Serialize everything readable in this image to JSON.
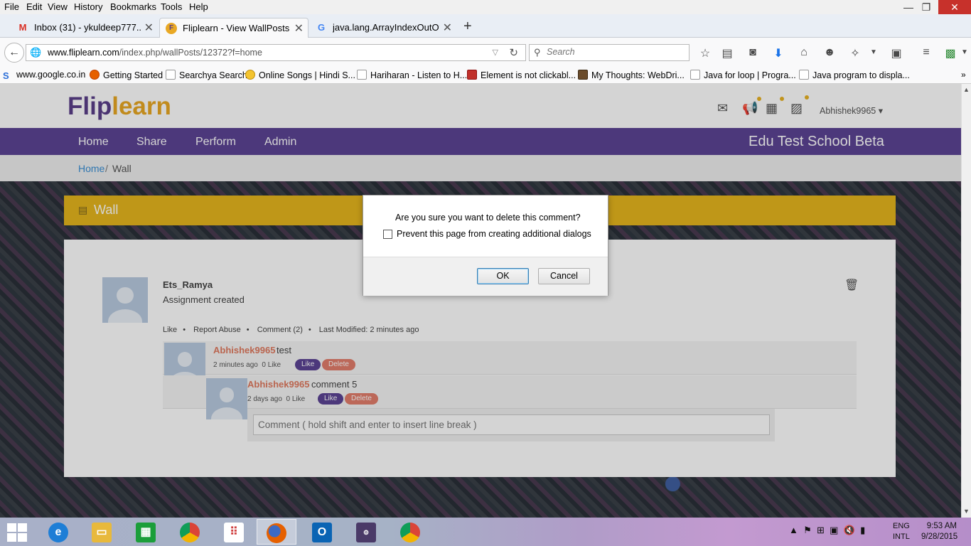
{
  "menu": [
    "File",
    "Edit",
    "View",
    "History",
    "Bookmarks",
    "Tools",
    "Help"
  ],
  "window_controls": {
    "minimize": "—",
    "restore": "❐",
    "close": "✕"
  },
  "tabs": [
    {
      "title": "Inbox (31) - ykuldeep777...",
      "icon": "gmail-icon",
      "letter": "M"
    },
    {
      "title": "Fliplearn - View WallPosts",
      "icon": "fliplearn-icon",
      "letter": "F"
    },
    {
      "title": "java.lang.ArrayIndexOutOf...",
      "icon": "google-icon",
      "letter": "G"
    }
  ],
  "address": {
    "host": "www.fliplearn.com",
    "path": "/index.php/wallPosts/12372?f=home"
  },
  "search": {
    "placeholder": "Search"
  },
  "bookmarks": [
    "www.google.co.in",
    "Getting Started",
    "Searchya Search",
    "Online Songs | Hindi S...",
    "Hariharan - Listen to H...",
    "Element is not clickabl...",
    "My Thoughts: WebDri...",
    "Java for loop | Progra...",
    "Java program to displa..."
  ],
  "site": {
    "logo_part1": "Flip",
    "logo_part2": "learn",
    "user": "Abhishek9965 ▾",
    "nav": [
      "Home",
      "Share",
      "Perform",
      "Admin"
    ],
    "school": "Edu Test School Beta",
    "breadcrumb": {
      "home": "Home",
      "sep": "/",
      "current": "Wall"
    },
    "wall_title": "Wall"
  },
  "post": {
    "author": "Ets_Ramya",
    "text": "Assignment created",
    "actions": {
      "like": "Like",
      "report": "Report Abuse",
      "comments": "Comment (2)",
      "modified": "Last Modified: 2 minutes ago"
    },
    "comments": [
      {
        "author": "Abhishek9965",
        "text": "test",
        "time": "2 minutes ago",
        "likes": "0 Like",
        "like_btn": "Like",
        "delete_btn": "Delete"
      },
      {
        "author": "Abhishek9965",
        "text": "comment 5",
        "time": "2 days ago",
        "likes": "0 Like",
        "like_btn": "Like",
        "delete_btn": "Delete"
      }
    ],
    "comment_placeholder": "Comment ( hold shift and enter to insert line break )"
  },
  "dialog": {
    "message": "Are you sure you want to delete this comment?",
    "checkbox_label": "Prevent this page from creating additional dialogs",
    "ok": "OK",
    "cancel": "Cancel"
  },
  "taskbar": {
    "lang_line1": "ENG",
    "lang_line2": "INTL",
    "time": "9:53 AM",
    "date": "9/28/2015"
  }
}
